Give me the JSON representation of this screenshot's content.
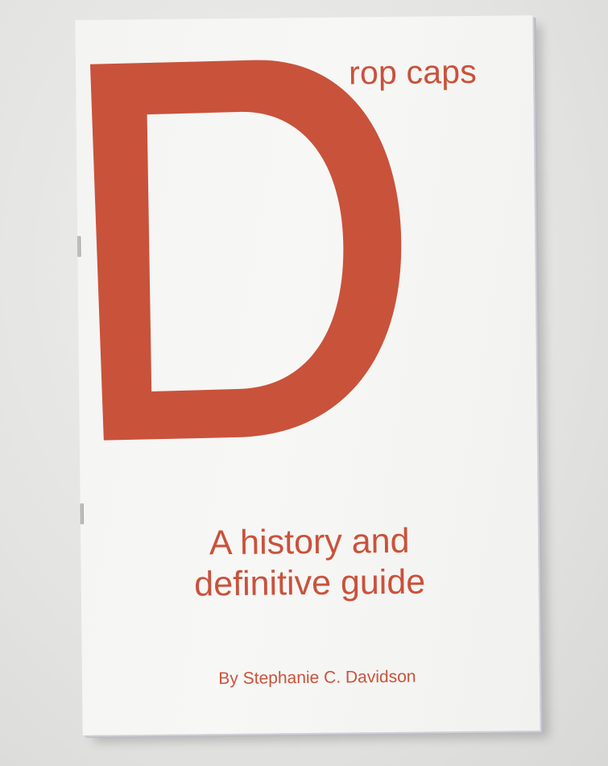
{
  "cover": {
    "drop_cap_letter": "D",
    "title_rest": "rop caps",
    "subtitle_line1": "A history and",
    "subtitle_line2": "definitive guide",
    "author": "By Stephanie C. Davidson"
  },
  "colors": {
    "ink": "#c9523b",
    "paper": "#f5f5f3",
    "background": "#e6e6e4"
  }
}
